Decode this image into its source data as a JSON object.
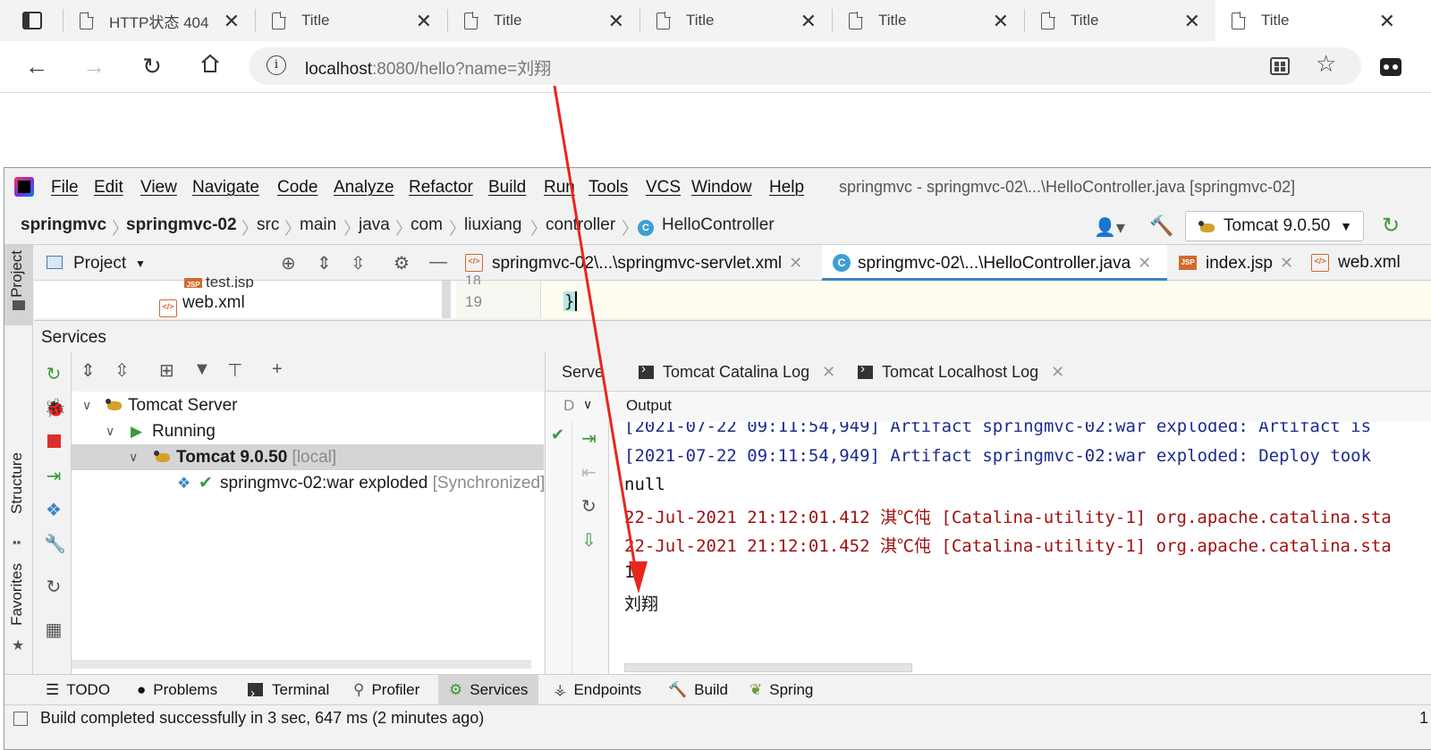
{
  "browser": {
    "tabs": [
      {
        "title": "HTTP状态 404"
      },
      {
        "title": "Title"
      },
      {
        "title": "Title"
      },
      {
        "title": "Title"
      },
      {
        "title": "Title"
      },
      {
        "title": "Title"
      },
      {
        "title": "Title"
      }
    ],
    "close_glyph": "✕",
    "url_host": "localhost",
    "url_rest": ":8080/hello?name=刘翔",
    "info_glyph": "i"
  },
  "ide": {
    "menu": [
      "File",
      "Edit",
      "View",
      "Navigate",
      "Code",
      "Analyze",
      "Refactor",
      "Build",
      "Run",
      "Tools",
      "VCS",
      "Window",
      "Help"
    ],
    "window_title": "springmvc - springmvc-02\\...\\HelloController.java [springmvc-02]",
    "breadcrumb": [
      "springmvc",
      "springmvc-02",
      "src",
      "main",
      "java",
      "com",
      "liuxiang",
      "controller",
      "HelloController"
    ],
    "class_glyph": "C",
    "run_config": "Tomcat 9.0.50",
    "project_label": "Project",
    "tree_partial": "test.jsp",
    "tree_webxml": "web.xml",
    "editor_tabs": [
      {
        "label": "springmvc-02\\...\\springmvc-servlet.xml"
      },
      {
        "label": "springmvc-02\\...\\HelloController.java"
      },
      {
        "label": "index.jsp"
      },
      {
        "label": "web.xml"
      }
    ],
    "editor_line_number": "19",
    "editor_line_prev": "18",
    "editor_code": "}",
    "side_labels": {
      "project": "Project",
      "structure": "Structure",
      "favorites": "Favorites"
    },
    "services_title": "Services",
    "services_tree": {
      "server": "Tomcat Server",
      "running": "Running",
      "instance": "Tomcat 9.0.50",
      "instance_tag": "[local]",
      "artifact": "springmvc-02:war exploded",
      "artifact_status": "[Synchronized]"
    },
    "right_tabs": [
      "Server",
      "Tomcat Catalina Log",
      "Tomcat Localhost Log"
    ],
    "output_label": "Output",
    "deploy_col_label": "D",
    "console_lines": [
      {
        "text": "[2021-07-22 09:11:54,949] Artifact springmvc-02:war exploded: Artifact is",
        "color": "#1d2b8f"
      },
      {
        "text": "[2021-07-22 09:11:54,949] Artifact springmvc-02:war exploded: Deploy took",
        "color": "#1d2b8f"
      },
      {
        "text": "null",
        "color": "#111111"
      },
      {
        "text": "22-Jul-2021 21:12:01.412 淇℃伅 [Catalina-utility-1] org.apache.catalina.sta",
        "color": "#a01010"
      },
      {
        "text": "22-Jul-2021 21:12:01.452 淇℃伅 [Catalina-utility-1] org.apache.catalina.sta",
        "color": "#a01010"
      },
      {
        "text": "1",
        "color": "#111111"
      },
      {
        "text": "刘翔",
        "color": "#111111"
      }
    ],
    "tool_windows": [
      "TODO",
      "Problems",
      "Terminal",
      "Profiler",
      "Services",
      "Endpoints",
      "Build",
      "Spring"
    ],
    "status_message": "Build completed successfully in 3 sec, 647 ms (2 minutes ago)",
    "status_right": "1"
  },
  "colors": {
    "annotation_arrow": "#e8261e",
    "accent": "#4083c9"
  }
}
